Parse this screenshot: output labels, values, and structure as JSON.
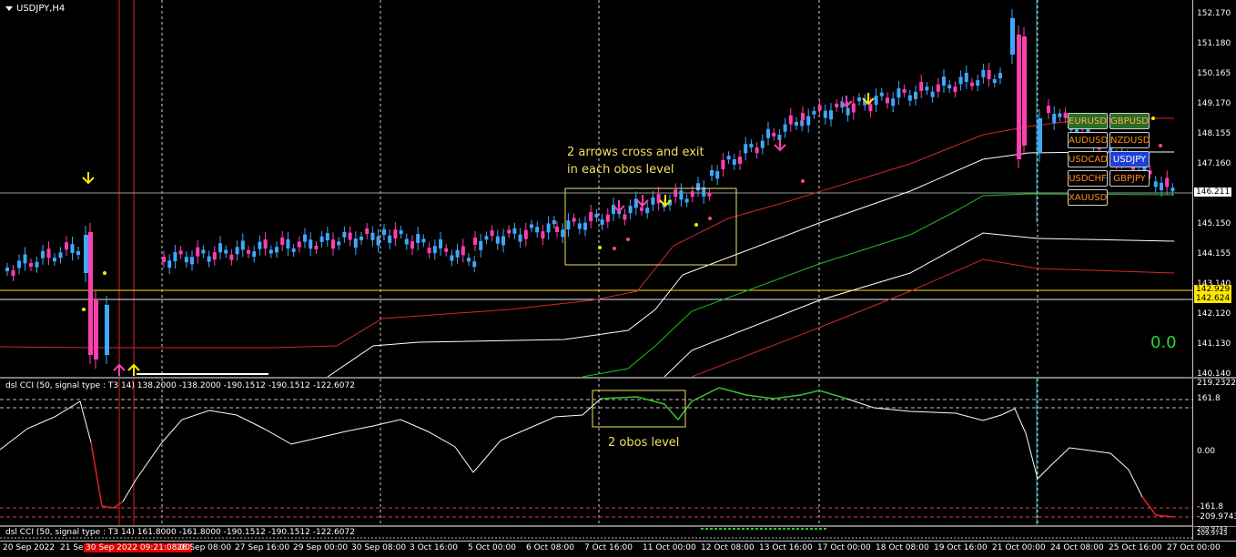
{
  "chart_title": "USDJPY,H4",
  "main_price_ticks": [
    "152.170",
    "151.180",
    "150.165",
    "149.170",
    "148.155",
    "147.160",
    "146.145",
    "145.150",
    "144.155",
    "143.140",
    "142.120",
    "141.130",
    "140.140"
  ],
  "current_price_tag": "146.211",
  "hline_tags": [
    "142.929",
    "142.624"
  ],
  "big_value": "0.0",
  "annotations": {
    "arrows_note_line1": "2 arrows cross and exit",
    "arrows_note_line2": "in each obos level",
    "obos_note": "2 obos level"
  },
  "symbol_buttons": [
    {
      "label": "EURUSD",
      "state": "active"
    },
    {
      "label": "GBPUSD",
      "state": "active"
    },
    {
      "label": "AUDUSD",
      "state": "normal"
    },
    {
      "label": "NZDUSD",
      "state": "normal"
    },
    {
      "label": "USDCAD",
      "state": "normal"
    },
    {
      "label": "USDJPY",
      "state": "current"
    },
    {
      "label": "USDCHF",
      "state": "normal"
    },
    {
      "label": "GBPJPY",
      "state": "normal"
    },
    {
      "label": "XAUUSD",
      "state": "normal"
    }
  ],
  "cci_label": "dsl CCI  (50, signal type : T3  14) 138.2000 -138.2000 -190.1512 -190.1512 -122.6072",
  "cci_ticks": [
    "219.2322",
    "161.8",
    "0.00",
    "-161.8",
    "-209.9743"
  ],
  "mini_label": "dsl CCI  (50, signal type : T3  14) 161.8000 -161.8000 -190.1512 -190.1512 -122.6072",
  "mini_ticks": [
    "209.9743",
    "209.9743"
  ],
  "time_labels": [
    "20 Sep 2022",
    "21 Sep",
    "30 Sep 2022 09:21:08:00",
    "26 Sep 08:00",
    "27 Sep 16:00",
    "29 Sep 00:00",
    "30 Sep 08:00",
    "3 Oct 16:00",
    "5 Oct 00:00",
    "6 Oct 08:00",
    "7 Oct 16:00",
    "11 Oct 00:00",
    "12 Oct 08:00",
    "13 Oct 16:00",
    "17 Oct 00:00",
    "18 Oct 08:00",
    "19 Oct 16:00",
    "21 Oct 00:00",
    "24 Oct 08:00",
    "25 Oct 16:00",
    "27 Oct 00:00"
  ],
  "colors": {
    "bull_candle": "#3fa7ff",
    "bear_candle": "#ff3fae",
    "band_red": "#d02a2a",
    "band_white": "#ffffff",
    "band_green": "#1fbf1f",
    "grid": "#cfcfcf",
    "annotation": "#f0e060"
  }
}
